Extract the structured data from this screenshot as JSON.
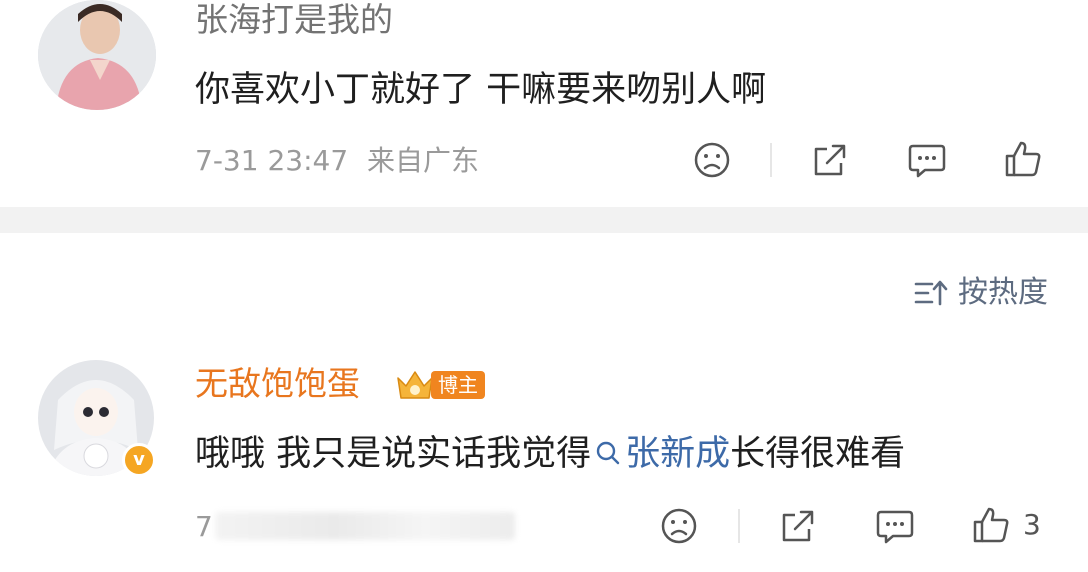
{
  "comments": [
    {
      "username": "张海打是我的",
      "text": "你喜欢小丁就好了 干嘛要来吻别人啊",
      "timestamp": "7-31 23:47",
      "location": "来自广东"
    },
    {
      "username": "无敌饱饱蛋",
      "badge_label": "博主",
      "verified_label": "v",
      "text_before": "哦哦 我只是说实话我觉得",
      "link_text": "张新成",
      "text_after": "长得很难看",
      "timestamp": "7",
      "like_count": "3"
    }
  ],
  "sort": {
    "label": "按热度"
  },
  "icons": {
    "dislike": "sad-face-icon",
    "share": "share-icon",
    "comment": "comment-icon",
    "like": "thumbs-up-icon",
    "sort": "sort-icon",
    "search": "search-icon"
  },
  "colors": {
    "accent_username": "#e8761e",
    "username_gray": "#737373",
    "link": "#3d6aa8",
    "meta": "#9a9a9a",
    "separator": "#f2f2f2"
  }
}
